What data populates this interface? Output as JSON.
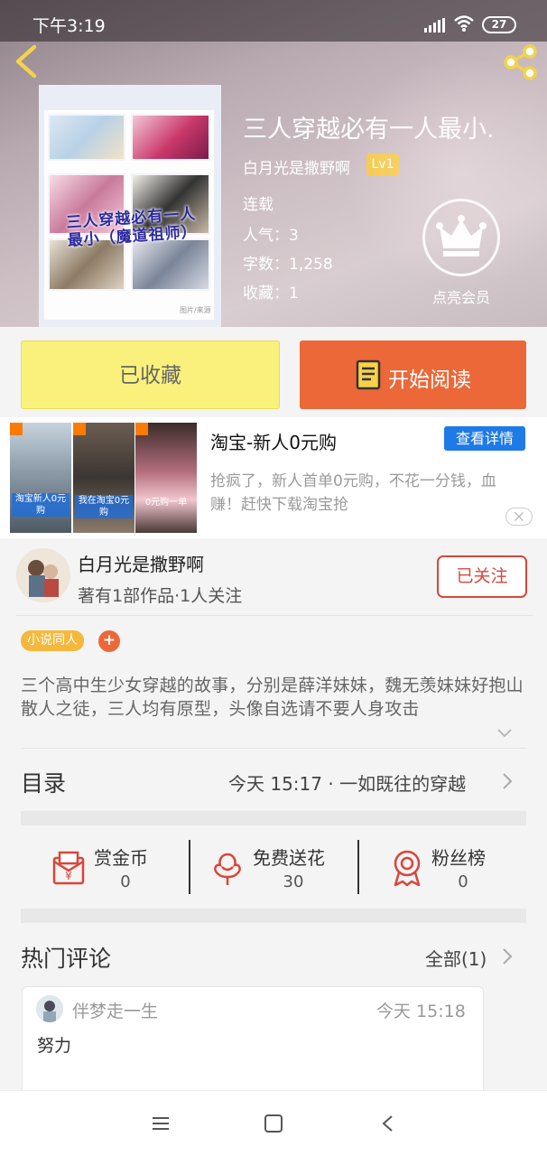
{
  "status_bar": {
    "time": "下午3:19",
    "battery": "27"
  },
  "book": {
    "title": "三人穿越必有一人最小.",
    "author": "白月光是撒野啊",
    "level": "Lv1",
    "status": "连载",
    "popularity": "人气：3",
    "word_count": "字数：1,258",
    "favorites": "收藏：1",
    "cover_text": "三人穿越必有一人最小（魔道祖师）",
    "cover_caption": "图片/来源"
  },
  "vip": {
    "label": "点亮会员",
    "icon": "crown-icon"
  },
  "actions": {
    "collected_label": "已收藏",
    "read_label": "开始阅读"
  },
  "ad": {
    "title": "淘宝-新人0元购",
    "detail_label": "查看详情",
    "description": "抢疯了，新人首单0元购，不花一分钱，血赚！赶快下载淘宝抢",
    "image_captions": [
      "淘宝新人0元购",
      "我在淘宝0元购",
      "0元购一单"
    ]
  },
  "author_section": {
    "name": "白月光是撒野啊",
    "stats": "著有1部作品·1人关注",
    "follow_label": "已关注"
  },
  "tags": {
    "items": [
      "小说同人"
    ],
    "add_label": "+"
  },
  "synopsis": "三个高中生少女穿越的故事，分别是薛洋妹妹，魏无羡妹妹好抱山散人之徒，三人均有原型，头像自选请不要人身攻击",
  "toc": {
    "title": "目录",
    "latest": "今天 15:17 · 一如既往的穿越"
  },
  "stats": [
    {
      "label": "赏金币",
      "value": "0",
      "icon": "red-envelope-icon"
    },
    {
      "label": "免费送花",
      "value": "30",
      "icon": "flower-icon"
    },
    {
      "label": "粉丝榜",
      "value": "0",
      "icon": "medal-icon"
    }
  ],
  "comments": {
    "title": "热门评论",
    "all_label": "全部(1)",
    "items": [
      {
        "user": "伴梦走一生",
        "time": "今天 15:18",
        "text": "努力"
      }
    ]
  },
  "colors": {
    "accent_orange": "#ec6838",
    "collected_yellow": "#faf17d",
    "follow_red": "#d9463a",
    "ad_blue": "#1e7ae6",
    "tag_yellow": "#f6b83c"
  }
}
